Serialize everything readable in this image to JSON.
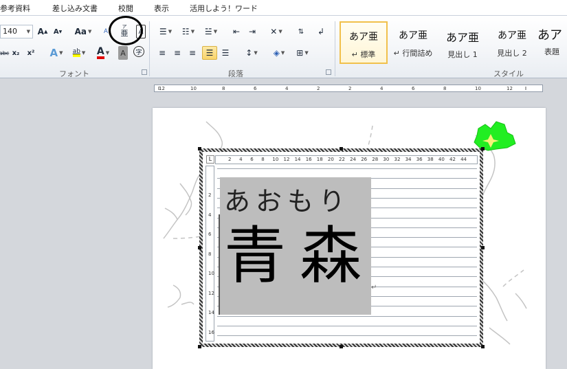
{
  "tabs": [
    {
      "label": "参考資料"
    },
    {
      "label": "差し込み文書"
    },
    {
      "label": "校閲"
    },
    {
      "label": "表示"
    },
    {
      "label": "活用しよう！ワード"
    }
  ],
  "font_group": {
    "font_size_value": "140",
    "label": "フォント",
    "grow_font_label": "A",
    "shrink_font_label": "A",
    "change_case_label": "Aa",
    "phonetic_guide_label": "亜",
    "phonetic_guide_ruby": "ア",
    "char_border_label": "A",
    "strike_label": "abc",
    "subscript_label": "x₂",
    "superscript_label": "x²",
    "text_effect_label": "A",
    "highlight_label": "ab",
    "font_color_label": "A",
    "char_shading_label": "A",
    "enclose_char_label": "字"
  },
  "paragraph_group": {
    "label": "段落"
  },
  "styles_group": {
    "label": "スタイル",
    "items": [
      {
        "sample": "あア亜",
        "name": "↵ 標準",
        "selected": true
      },
      {
        "sample": "あア亜",
        "name": "↵ 行間詰め"
      },
      {
        "sample": "あア亜",
        "name": "見出し 1"
      },
      {
        "sample": "あア亜",
        "name": "見出し 2"
      },
      {
        "sample": "あア",
        "name": "表題"
      }
    ]
  },
  "ruler_main": {
    "labels": [
      "12",
      "10",
      "8",
      "6",
      "4",
      "2",
      "2",
      "4",
      "6",
      "8",
      "10",
      "12"
    ]
  },
  "ruler_inner_h": {
    "labels": [
      "2",
      "4",
      "6",
      "8",
      "10",
      "12",
      "14",
      "16",
      "18",
      "20",
      "22",
      "24",
      "26",
      "28",
      "30",
      "32",
      "34",
      "36",
      "38",
      "40",
      "42",
      "44"
    ]
  },
  "ruler_inner_v": {
    "labels": [
      "2",
      "4",
      "6",
      "8",
      "10",
      "12",
      "14",
      "16"
    ]
  },
  "document": {
    "ruby_text": "あおもり",
    "main_text": "青森",
    "paragraph_mark": "↵"
  },
  "colors": {
    "accent_highlight": "#f9d46b",
    "map_region": "#22ee22",
    "selection_gray": "#bdbdbd"
  }
}
